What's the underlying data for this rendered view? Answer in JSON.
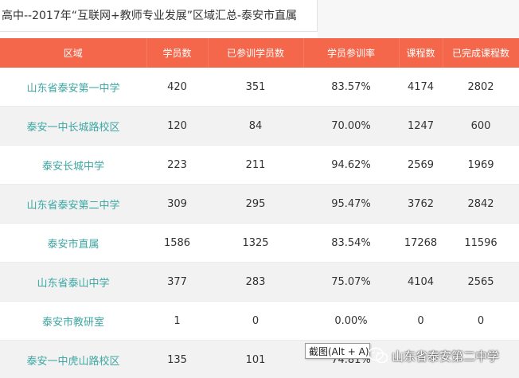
{
  "page_title": "高中--2017年“互联网+教师专业发展”区域汇总-泰安市直属",
  "columns": [
    "区域",
    "学员数",
    "已参训学员数",
    "学员参训率",
    "课程数",
    "已完成课程数"
  ],
  "rows": [
    {
      "area": "山东省泰安第一中学",
      "students": "420",
      "trained": "351",
      "rate": "83.57%",
      "courses": "4174",
      "completed": "2802"
    },
    {
      "area": "泰安一中长城路校区",
      "students": "120",
      "trained": "84",
      "rate": "70.00%",
      "courses": "1247",
      "completed": "600"
    },
    {
      "area": "泰安长城中学",
      "students": "223",
      "trained": "211",
      "rate": "94.62%",
      "courses": "2569",
      "completed": "1969"
    },
    {
      "area": "山东省泰安第二中学",
      "students": "309",
      "trained": "295",
      "rate": "95.47%",
      "courses": "3762",
      "completed": "2842"
    },
    {
      "area": "泰安市直属",
      "students": "1586",
      "trained": "1325",
      "rate": "83.54%",
      "courses": "17268",
      "completed": "11596"
    },
    {
      "area": "山东省泰山中学",
      "students": "377",
      "trained": "283",
      "rate": "75.07%",
      "courses": "4104",
      "completed": "2565"
    },
    {
      "area": "泰安市教研室",
      "students": "1",
      "trained": "0",
      "rate": "0.00%",
      "courses": "0",
      "completed": "0"
    },
    {
      "area": "泰安一中虎山路校区",
      "students": "135",
      "trained": "101",
      "rate": "74.81%",
      "courses": "",
      "completed": ""
    }
  ],
  "tooltip": "截图(Alt + A)",
  "watermark": "山东省泰安第二中学",
  "icons": {
    "watermark_icon": "wechat-icon"
  },
  "colors": {
    "header_bg": "#f5674a",
    "area_link": "#3ea7a3",
    "stripe": "#f2f2f2"
  }
}
